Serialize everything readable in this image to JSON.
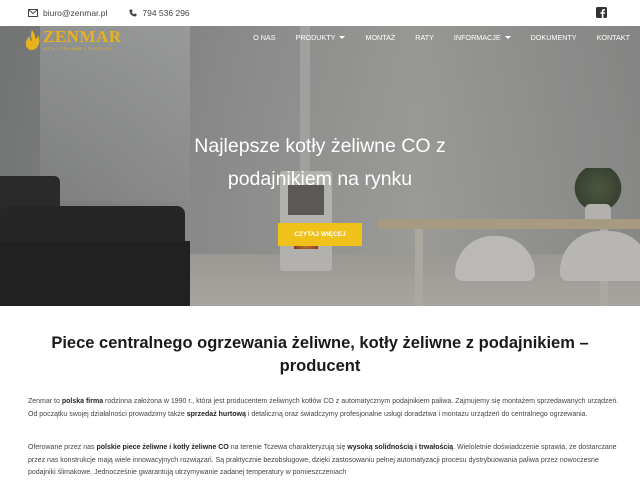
{
  "topbar": {
    "email": "biuro@zenmar.pl",
    "phone": "794 536 296",
    "icons": {
      "email": "envelope-icon",
      "phone": "phone-icon",
      "facebook": "facebook-icon"
    }
  },
  "logo": {
    "brand": "ZENMAR",
    "tagline": "KOTŁY ŻELIWNE I PIECE CO",
    "icon": "flame-icon"
  },
  "nav": {
    "items": [
      {
        "label": "O NAS",
        "dropdown": false
      },
      {
        "label": "PRODUKTY",
        "dropdown": true
      },
      {
        "label": "MONTAŻ",
        "dropdown": false
      },
      {
        "label": "RATY",
        "dropdown": false
      },
      {
        "label": "INFORMACJE",
        "dropdown": true
      },
      {
        "label": "DOKUMENTY",
        "dropdown": false
      },
      {
        "label": "KONTAKT",
        "dropdown": false
      }
    ]
  },
  "hero": {
    "title": "Najlepsze kotły żeliwne CO z podajnikiem na rynku",
    "cta": "CZYTAJ WIĘCEJ"
  },
  "content": {
    "heading": "Piece centralnego ogrzewania żeliwne, kotły żeliwne z podajnikiem – producent",
    "p1": {
      "t1": "Zenmar to ",
      "b1": "polska firma",
      "t2": " rodzinna założona w 1990 r., która jest producentem żeliwnych kotłów CO z automatycznym podajnikiem paliwa. Zajmujemy się montażem sprzedawanych urządzeń. Od początku swojej działalności prowadzimy także ",
      "b2": "sprzedaż hurtową",
      "t3": " i detaliczną oraz świadczymy profesjonalne usługi doradztwa i montażu urządzeń do centralnego ogrzewania."
    },
    "p2": {
      "t1": "Oferowane przez nas ",
      "b1": "polskie piece żeliwne i kotły żeliwne CO",
      "t2": " na terenie Tczewa charakteryzują się ",
      "b2": "wysoką solidnością i trwałością",
      "t3": ". Wieloletnie doświadczenie sprawia, że dostarczane przez nas konstrukcje mają wiele innowacyjnych rozwiązań. Są praktycznie bezobsługowe, dzięki zastosowaniu pełnej automatyzacji procesu dystrybuowania paliwa przez nowoczesne podajniki ślimakowe. Jednocześnie gwarantują utrzymywanie zadanej temperatury w pomieszczeniach"
    }
  },
  "colors": {
    "accent": "#f0c11a",
    "logo": "#e8b11e",
    "heading": "#1a1a1a"
  }
}
